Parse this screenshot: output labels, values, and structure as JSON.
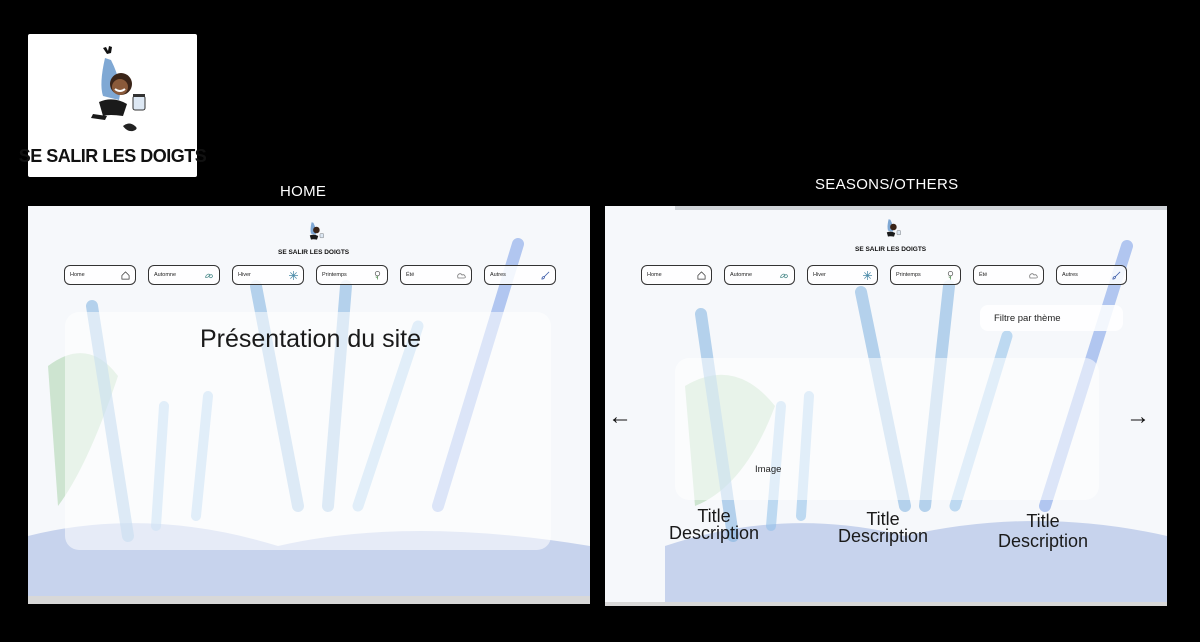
{
  "logo": {
    "text": "SE SALIR LES DOIGTS"
  },
  "home": {
    "label": "HOME",
    "presentation_title": "Présentation du site"
  },
  "seasons": {
    "label": "SEASONS/OTHERS",
    "filter_label": "Filtre par thème",
    "prev_arrow": "←",
    "next_arrow": "→",
    "image_label": "Image",
    "cards": [
      {
        "title": "Title",
        "description": "Description"
      },
      {
        "title": "Title",
        "description": "Description"
      },
      {
        "title": "Title",
        "description": "Description"
      }
    ]
  },
  "nav": [
    {
      "label": "Home",
      "icon": "house-icon"
    },
    {
      "label": "Automne",
      "icon": "leaves-icon"
    },
    {
      "label": "Hiver",
      "icon": "snowflake-icon"
    },
    {
      "label": "Printemps",
      "icon": "flower-icon"
    },
    {
      "label": "Été",
      "icon": "sun-cloud-icon"
    },
    {
      "label": "Autres",
      "icon": "brush-icon"
    }
  ],
  "colors": {
    "background": "#000000",
    "pencil_blue": "#7fb3e0",
    "panel": "#ffffff"
  }
}
